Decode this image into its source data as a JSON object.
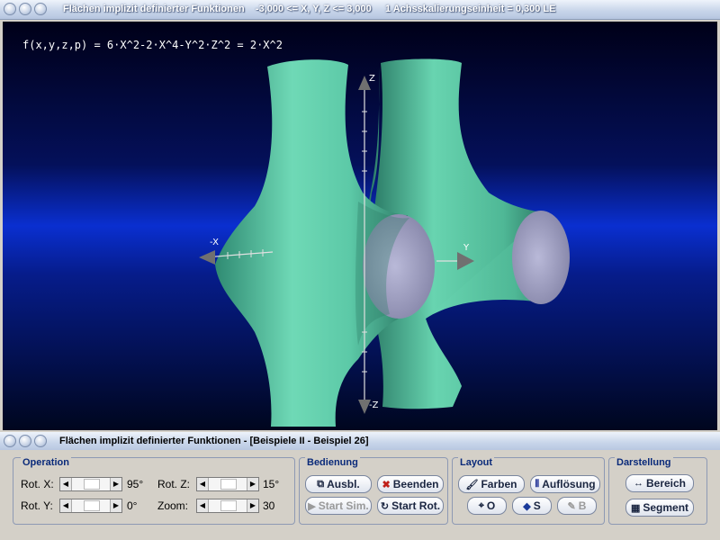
{
  "main_window": {
    "title": "Flächen implizit definierter Funktionen    -3,000 <= X, Y, Z <= 3,000     1 Achsskalierungseinheit = 0,300 LE"
  },
  "plot": {
    "formula": "f(x,y,z,p) = 6·X^2-2·X^4-Y^2·Z^2 = 2·X^2",
    "axis_labels": {
      "z_top": "Z",
      "z_bottom": "-Z",
      "x_neg": "-X",
      "y": "Y"
    },
    "colors": {
      "surface": "#5cc9a7",
      "cap": "#a8a8c8",
      "background_top": "#000020",
      "background_band": "#0a2fd0"
    }
  },
  "control_window": {
    "title": "Flächen implizit definierter Funktionen - [Beispiele II - Beispiel 26]"
  },
  "operation": {
    "title": "Operation",
    "rot_x": {
      "label": "Rot. X:",
      "value": "95°"
    },
    "rot_y": {
      "label": "Rot. Y:",
      "value": "0°"
    },
    "rot_z": {
      "label": "Rot. Z:",
      "value": "15°"
    },
    "zoom": {
      "label": "Zoom:",
      "value": "30"
    }
  },
  "bedienung": {
    "title": "Bedienung",
    "ausbl": "Ausbl.",
    "beenden": "Beenden",
    "start_sim": "Start Sim.",
    "start_rot": "Start Rot."
  },
  "layout": {
    "title": "Layout",
    "farben": "Farben",
    "aufloesung": "Auflösung",
    "o": "O",
    "s": "S",
    "b": "B"
  },
  "darstellung": {
    "title": "Darstellung",
    "bereich": "Bereich",
    "segment": "Segment"
  }
}
